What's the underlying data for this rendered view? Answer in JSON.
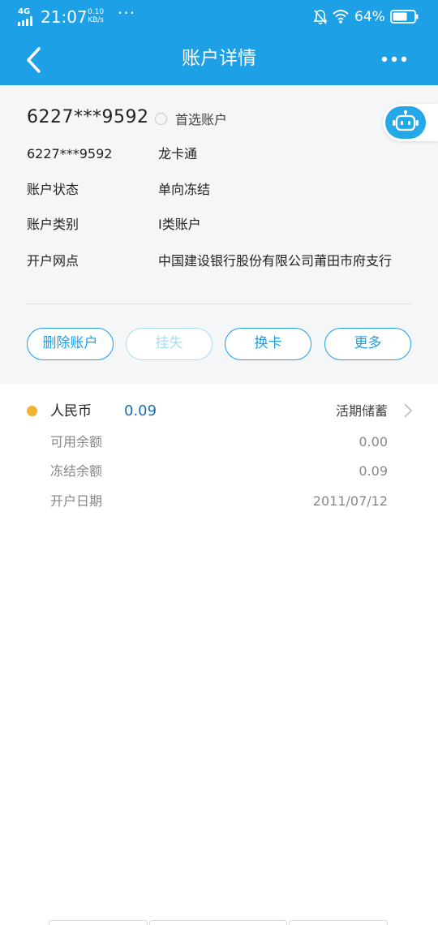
{
  "status_bar": {
    "network": "4G",
    "time": "21:07",
    "speed_value": "0.10",
    "speed_unit": "KB/s",
    "more_dots": "···",
    "battery": "64%"
  },
  "header": {
    "title": "账户详情",
    "back_icon": "chevron-left-icon",
    "more_icon": "more-dots-icon"
  },
  "account": {
    "number_main": "6227***9592",
    "preferred_label": "首选账户",
    "rows": [
      {
        "label": "6227***9592",
        "value": "龙卡通"
      },
      {
        "label": "账户状态",
        "value": "单向冻结"
      },
      {
        "label": "账户类别",
        "value": "I类账户"
      },
      {
        "label": "开户网点",
        "value": "中国建设银行股份有限公司莆田市府支行"
      }
    ]
  },
  "actions": [
    {
      "label": "删除账户",
      "enabled": true
    },
    {
      "label": "挂失",
      "enabled": false
    },
    {
      "label": "换卡",
      "enabled": true
    },
    {
      "label": "更多",
      "enabled": true
    }
  ],
  "balance": {
    "currency": "人民币",
    "amount": "0.09",
    "type": "活期储蓄",
    "rows": [
      {
        "label": "可用余额",
        "value": "0.00"
      },
      {
        "label": "冻结余额",
        "value": "0.09"
      },
      {
        "label": "开户日期",
        "value": "2011/07/12"
      }
    ]
  },
  "colors": {
    "brand": "#1ea0e6",
    "button_border": "#1f9ee4",
    "amount": "#1a6fb0",
    "currency_dot": "#f0b42c"
  }
}
